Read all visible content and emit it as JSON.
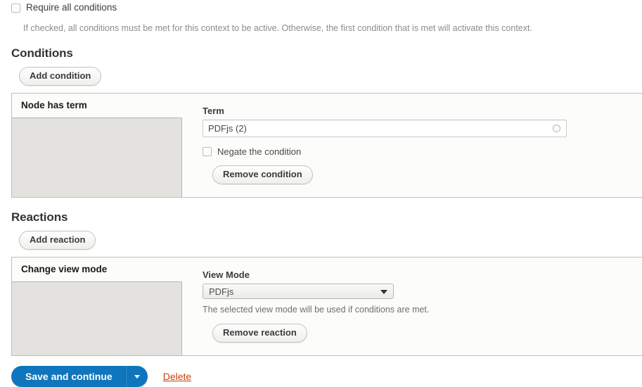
{
  "require_all": {
    "checkbox_checked": false,
    "label": "Require all conditions",
    "description": "If checked, all conditions must be met for this context to be active. Otherwise, the first condition that is met will activate this context."
  },
  "conditions": {
    "heading": "Conditions",
    "add_button": "Add condition",
    "tab_title": "Node has term",
    "term_field": {
      "label": "Term",
      "value": "PDFjs (2)",
      "placeholder": "",
      "icon": "autocomplete-throbber-icon"
    },
    "negate": {
      "label": "Negate the condition",
      "checked": false
    },
    "remove_button": "Remove condition"
  },
  "reactions": {
    "heading": "Reactions",
    "add_button": "Add reaction",
    "tab_title": "Change view mode",
    "view_mode_field": {
      "label": "View Mode",
      "selected": "PDFjs",
      "description": "The selected view mode will be used if conditions are met."
    },
    "remove_button": "Remove reaction"
  },
  "actions": {
    "save_label": "Save and continue",
    "dropdown_icon": "chevron-down-icon",
    "delete_label": "Delete",
    "primary_color": "#0f75bc",
    "delete_color": "#c9420b"
  }
}
